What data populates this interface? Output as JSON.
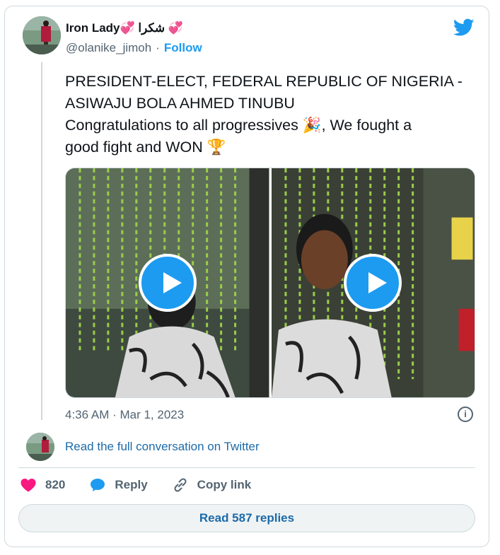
{
  "author": {
    "display_name": "Iron Lady💞 شكرا 💞",
    "handle": "@olanike_jimoh",
    "separator": "·",
    "follow_label": "Follow"
  },
  "tweet": {
    "lines": [
      "PRESIDENT-ELECT, FEDERAL REPUBLIC OF NIGERIA -",
      "ASIWAJU BOLA AHMED TINUBU",
      "Congratulations to all progressives 🎉, We fought a",
      "good fight and WON 🏆"
    ],
    "timestamp": "4:36 AM · Mar 1, 2023",
    "info_icon": "i"
  },
  "conversation_link": "Read the full conversation on Twitter",
  "actions": {
    "likes": "820",
    "reply_label": "Reply",
    "copy_label": "Copy link"
  },
  "read_replies": "Read 587 replies",
  "colors": {
    "accent": "#1d9bf0",
    "like": "#f91880",
    "muted": "#536471"
  }
}
